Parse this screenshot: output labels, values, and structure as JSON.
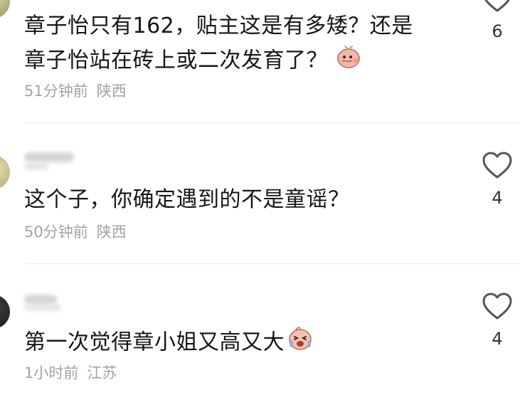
{
  "comments": [
    {
      "lines": [
        "章子怡只有162，贴主这是有多矮？还是",
        "章子怡站在砖上或二次发育了？"
      ],
      "emoji": "peach-face-emoji",
      "time": "51分钟前",
      "location": "陕西",
      "likes": "6"
    },
    {
      "text": "这个子，你确定遇到的不是童谣？",
      "time": "50分钟前",
      "location": "陕西",
      "likes": "4"
    },
    {
      "text": "第一次觉得章小姐又高又大",
      "emoji": "crying-face-emoji",
      "time": "1小时前",
      "location": "江苏",
      "likes": "4"
    }
  ],
  "icons": {
    "like": "heart-outline-icon"
  },
  "colors": {
    "text": "#161616",
    "meta": "#a3a3a3",
    "icon": "#555555",
    "divider": "#ececec"
  }
}
